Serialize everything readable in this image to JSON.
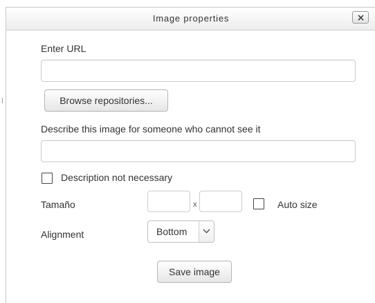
{
  "dialog": {
    "title": "Image properties",
    "close_icon": "close-x-icon"
  },
  "form": {
    "url_label": "Enter URL",
    "url_value": "",
    "browse_button": "Browse repositories...",
    "description_label": "Describe this image for someone who cannot see it",
    "description_value": "",
    "description_not_necessary_label": "Description not necessary",
    "description_not_necessary_checked": false,
    "size_label": "Tamaño",
    "width_value": "",
    "size_separator": "x",
    "height_value": "",
    "auto_size_label": "Auto size",
    "auto_size_checked": false,
    "alignment_label": "Alignment",
    "alignment_selected": "Bottom",
    "alignment_arrow_icon": "chevron-down-icon",
    "save_button": "Save image"
  }
}
